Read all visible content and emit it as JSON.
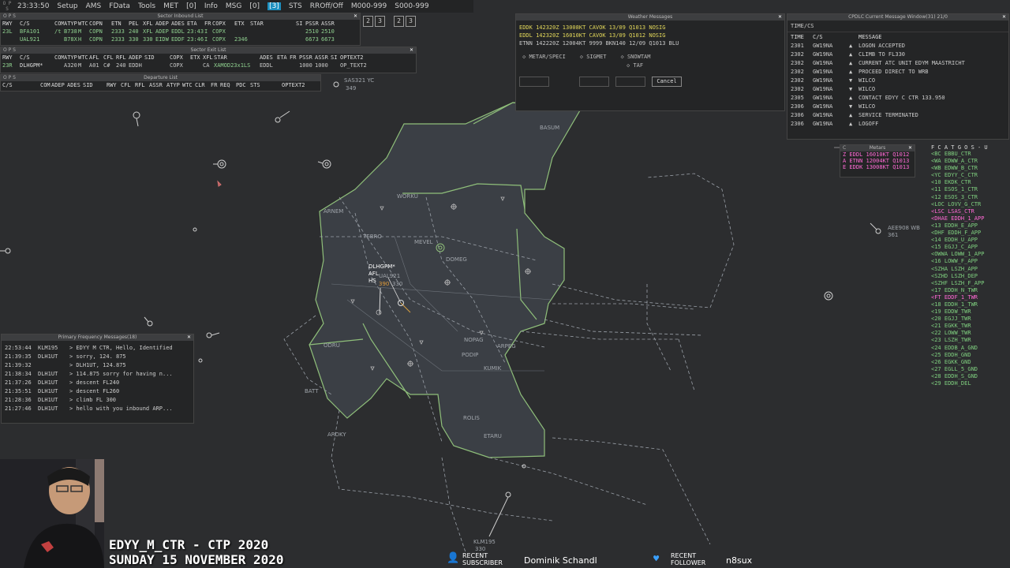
{
  "menubar": {
    "dots": "O P S",
    "time": "23:33:50",
    "items": [
      "Setup",
      "AMS",
      "FData",
      "Tools",
      "MET",
      "[0]",
      "Info",
      "MSG",
      "[0]",
      "[3]",
      "STS",
      "RROff/Off",
      "M000-999",
      "S000-999"
    ],
    "active_index": 9,
    "controls": [
      "2",
      "3",
      "2",
      "3"
    ]
  },
  "inbound": {
    "title": "Sector Inbound List",
    "headers": [
      "RWY",
      "C/S",
      "COM",
      "ATYP",
      "WTC",
      "COPN",
      "ETN",
      "PEL",
      "XFL",
      "ADEP",
      "ADES",
      "ETA",
      "FR",
      "COPX",
      "ETX",
      "STAR",
      "SI",
      "PSSR",
      "ASSR"
    ],
    "rows": [
      [
        "23L",
        "BFA101",
        "/t",
        "B738",
        "M",
        "COPN",
        "2333",
        "240",
        "XFL",
        "ADEP",
        "EDDL",
        "23:43",
        "I",
        "COPX",
        "",
        "",
        "",
        "2510",
        "2510"
      ],
      [
        "",
        "UAL921",
        "",
        "B78X",
        "H",
        "COPN",
        "2333",
        "330",
        "330",
        "EIDW",
        "EDDF",
        "23:46",
        "I",
        "COPX",
        "2346",
        "",
        "",
        "6673",
        "6673"
      ]
    ]
  },
  "exit": {
    "title": "Sector Exit List",
    "headers": [
      "RWY",
      "C/S",
      "COM",
      "ATYP",
      "WTC",
      "AFL",
      "CFL",
      "RFL",
      "ADEP",
      "SID",
      "COPX",
      "ETX",
      "XFL",
      "STAR",
      "ADES",
      "ETA",
      "FR",
      "PSSR",
      "ASSR",
      "SI",
      "OPTEXT2"
    ],
    "rows": [
      [
        "23R",
        "DLHGPM*",
        "",
        "A320",
        "M",
        "A01",
        "C#",
        "240",
        "EDDH",
        "",
        "COPX",
        "",
        "CA",
        "XAMOD23x1LS",
        "EDDL",
        "",
        "",
        "1000",
        "1000",
        "",
        "OP_TEXT2"
      ]
    ]
  },
  "departure": {
    "title": "Departure List",
    "headers": [
      "C/S",
      "COM",
      "ADEP",
      "ADES",
      "SID",
      "RWY",
      "CFL",
      "RFL",
      "ASSR",
      "ATYP",
      "WTC",
      "CLR",
      "FR",
      "REQ",
      "PDC",
      "STS",
      "OPTEXT2"
    ]
  },
  "weather": {
    "title": "Weather Messages",
    "lines": [
      {
        "text": "EDDK 142320Z 13008KT CAVOK 13/09 Q1013 NOSIG",
        "color": "#e3d85a"
      },
      {
        "text": "EDDL 142320Z 16010KT CAVOK 13/09 Q1012 NOSIG",
        "color": "#e3d85a"
      },
      {
        "text": "ETNN 142220Z 12004KT 9999 BKN140 12/09 Q1013 BLU",
        "color": "#c8c8c8"
      }
    ],
    "options": [
      "METAR/SPECI",
      "SIGMET",
      "SNOWTAM",
      "TAF"
    ],
    "cancel": "Cancel"
  },
  "cpdlc": {
    "title": "CPDLC Current Message Window(31) 21/0",
    "sub": "TIME/CS",
    "headers": [
      "TIME",
      "C/S",
      "MESSAGE"
    ],
    "rows": [
      [
        "2301",
        "GW19NA",
        "▲",
        "LOGON ACCEPTED"
      ],
      [
        "2302",
        "GW19NA",
        "▲",
        "CLIMB TO FL330"
      ],
      [
        "2302",
        "GW19NA",
        "▲",
        "CURRENT ATC UNIT EDYM MAASTRICHT"
      ],
      [
        "2302",
        "GW19NA",
        "▲",
        "PROCEED DIRECT TO WRB"
      ],
      [
        "2302",
        "GW19NA",
        "▼",
        "WILCO"
      ],
      [
        "2302",
        "GW19NA",
        "▼",
        "WILCO"
      ],
      [
        "2305",
        "GW19NA",
        "▲",
        "CONTACT EDYY C CTR 133.950"
      ],
      [
        "2306",
        "GW19NA",
        "▼",
        "WILCO"
      ],
      [
        "2306",
        "GW19NA",
        "▲",
        "SERVICE TERMINATED"
      ],
      [
        "2306",
        "GW19NA",
        "▲",
        "LOGOFF"
      ]
    ]
  },
  "metars": {
    "title": "Metars",
    "lines": [
      "Z EDDL 16010KT Q1012",
      "A ETNN 12004KT Q1013",
      "E EDDK 13008KT Q1013"
    ]
  },
  "freqs": {
    "header": "F C A T G O S - U",
    "items": [
      {
        "t": "<BC EBBU_CTR",
        "c": "g"
      },
      {
        "t": "<WA EDWW_A_CTR",
        "c": "g"
      },
      {
        "t": "<WB EDWW_B_CTR",
        "c": "g"
      },
      {
        "t": "<YC EDYY_C_CTR",
        "c": "g"
      },
      {
        "t": "<10 EKDK_CTR",
        "c": "g"
      },
      {
        "t": "<11 ESOS_1_CTR",
        "c": "g"
      },
      {
        "t": "<12 ESOS_3_CTR",
        "c": "g"
      },
      {
        "t": "<LOC LOVV_G_CTR",
        "c": "g"
      },
      {
        "t": "<LSC LSAS_CTR",
        "c": "m"
      },
      {
        "t": "<DHAE EDDH_1_APP",
        "c": "m"
      },
      {
        "t": "<13 EDDH_E_APP",
        "c": "g"
      },
      {
        "t": "<DHF EDDH_F_APP",
        "c": "g"
      },
      {
        "t": "<14 EDDH_U_APP",
        "c": "g"
      },
      {
        "t": "<15 EGJJ_C_APP",
        "c": "g"
      },
      {
        "t": "<OWWA LOWW_1_APP",
        "c": "g"
      },
      {
        "t": "<16 LOWW_F_APP",
        "c": "g"
      },
      {
        "t": "<SZHA LSZH_APP",
        "c": "g"
      },
      {
        "t": "<SZHD LSZH_DEP",
        "c": "g"
      },
      {
        "t": "<SZHF LSZH_F_APP",
        "c": "g"
      },
      {
        "t": "<17 EDDH_N_TWR",
        "c": "g"
      },
      {
        "t": "<FT EDDF_1_TWR",
        "c": "m"
      },
      {
        "t": "<18 EDDH_1_TWR",
        "c": "g"
      },
      {
        "t": "<19 EDDW_TWR",
        "c": "g"
      },
      {
        "t": "<20 EGJJ_TWR",
        "c": "g"
      },
      {
        "t": "<21 EGKK_TWR",
        "c": "g"
      },
      {
        "t": "<22 LOWW_TWR",
        "c": "g"
      },
      {
        "t": "<23 LSZH_TWR",
        "c": "g"
      },
      {
        "t": "<24 EDDB_A_GND",
        "c": "g"
      },
      {
        "t": "<25 EDDH_GND",
        "c": "g"
      },
      {
        "t": "<26 EGKK_GND",
        "c": "g"
      },
      {
        "t": "<27 EGLL_5_GND",
        "c": "g"
      },
      {
        "t": "<28 EDDH_S_GND",
        "c": "g"
      },
      {
        "t": "<29 EDDH_DEL",
        "c": "g"
      }
    ]
  },
  "pfm": {
    "title": "Primary Frequency Messages(18)",
    "rows": [
      [
        "22:53:44",
        "KLM195",
        "> EDYY M CTR, Hello, Identified"
      ],
      [
        "21:39:35",
        "DLH1UT",
        "> sorry, 124. 875"
      ],
      [
        "21:39:32",
        "",
        "> DLH1UT, 124.875"
      ],
      [
        "21:38:34",
        "DLH1UT",
        "> 114.875 sorry for having n..."
      ],
      [
        "21:37:26",
        "DLH1UT",
        "> descent FL240"
      ],
      [
        "21:35:51",
        "DLH1UT",
        "> descent FL260"
      ],
      [
        "21:28:36",
        "DLH1UT",
        "> climb FL 300"
      ],
      [
        "21:27:46",
        "DLH1UT",
        "> hello with you inbound ARP..."
      ]
    ]
  },
  "radar": {
    "waypoints": [
      "BASUM",
      "WORKU",
      "ARNEM",
      "TEBRO",
      "MEVEL",
      "DOMEG",
      "NOPAG",
      "ARPEG",
      "PODIP",
      "KUMIK",
      "ROLIS",
      "ETARU",
      "ODRU",
      "BATT",
      "ARDKY"
    ],
    "tracks": {
      "t1": {
        "cs": "SAS321 YC",
        "fl": "349"
      },
      "t2": {
        "cs": "AEE908 WB",
        "fl": "361"
      },
      "t3": {
        "cs": "KLM195",
        "fl": "330"
      },
      "dlh": {
        "cs": "DLHGPM*",
        "l2": "AFL",
        "l3": "HS",
        "v1": "390",
        "v2": "330"
      },
      "ual": {
        "cs": "UAL921"
      }
    }
  },
  "overlay": {
    "line1": "EDYY_M_CTR - CTP 2020",
    "line2": "SUNDAY 15 NOVEMBER 2020",
    "sub_label": "RECENT SUBSCRIBER",
    "sub_name": "Dominik Schandl",
    "fol_label": "RECENT FOLLOWER",
    "fol_name": "n8sux"
  }
}
